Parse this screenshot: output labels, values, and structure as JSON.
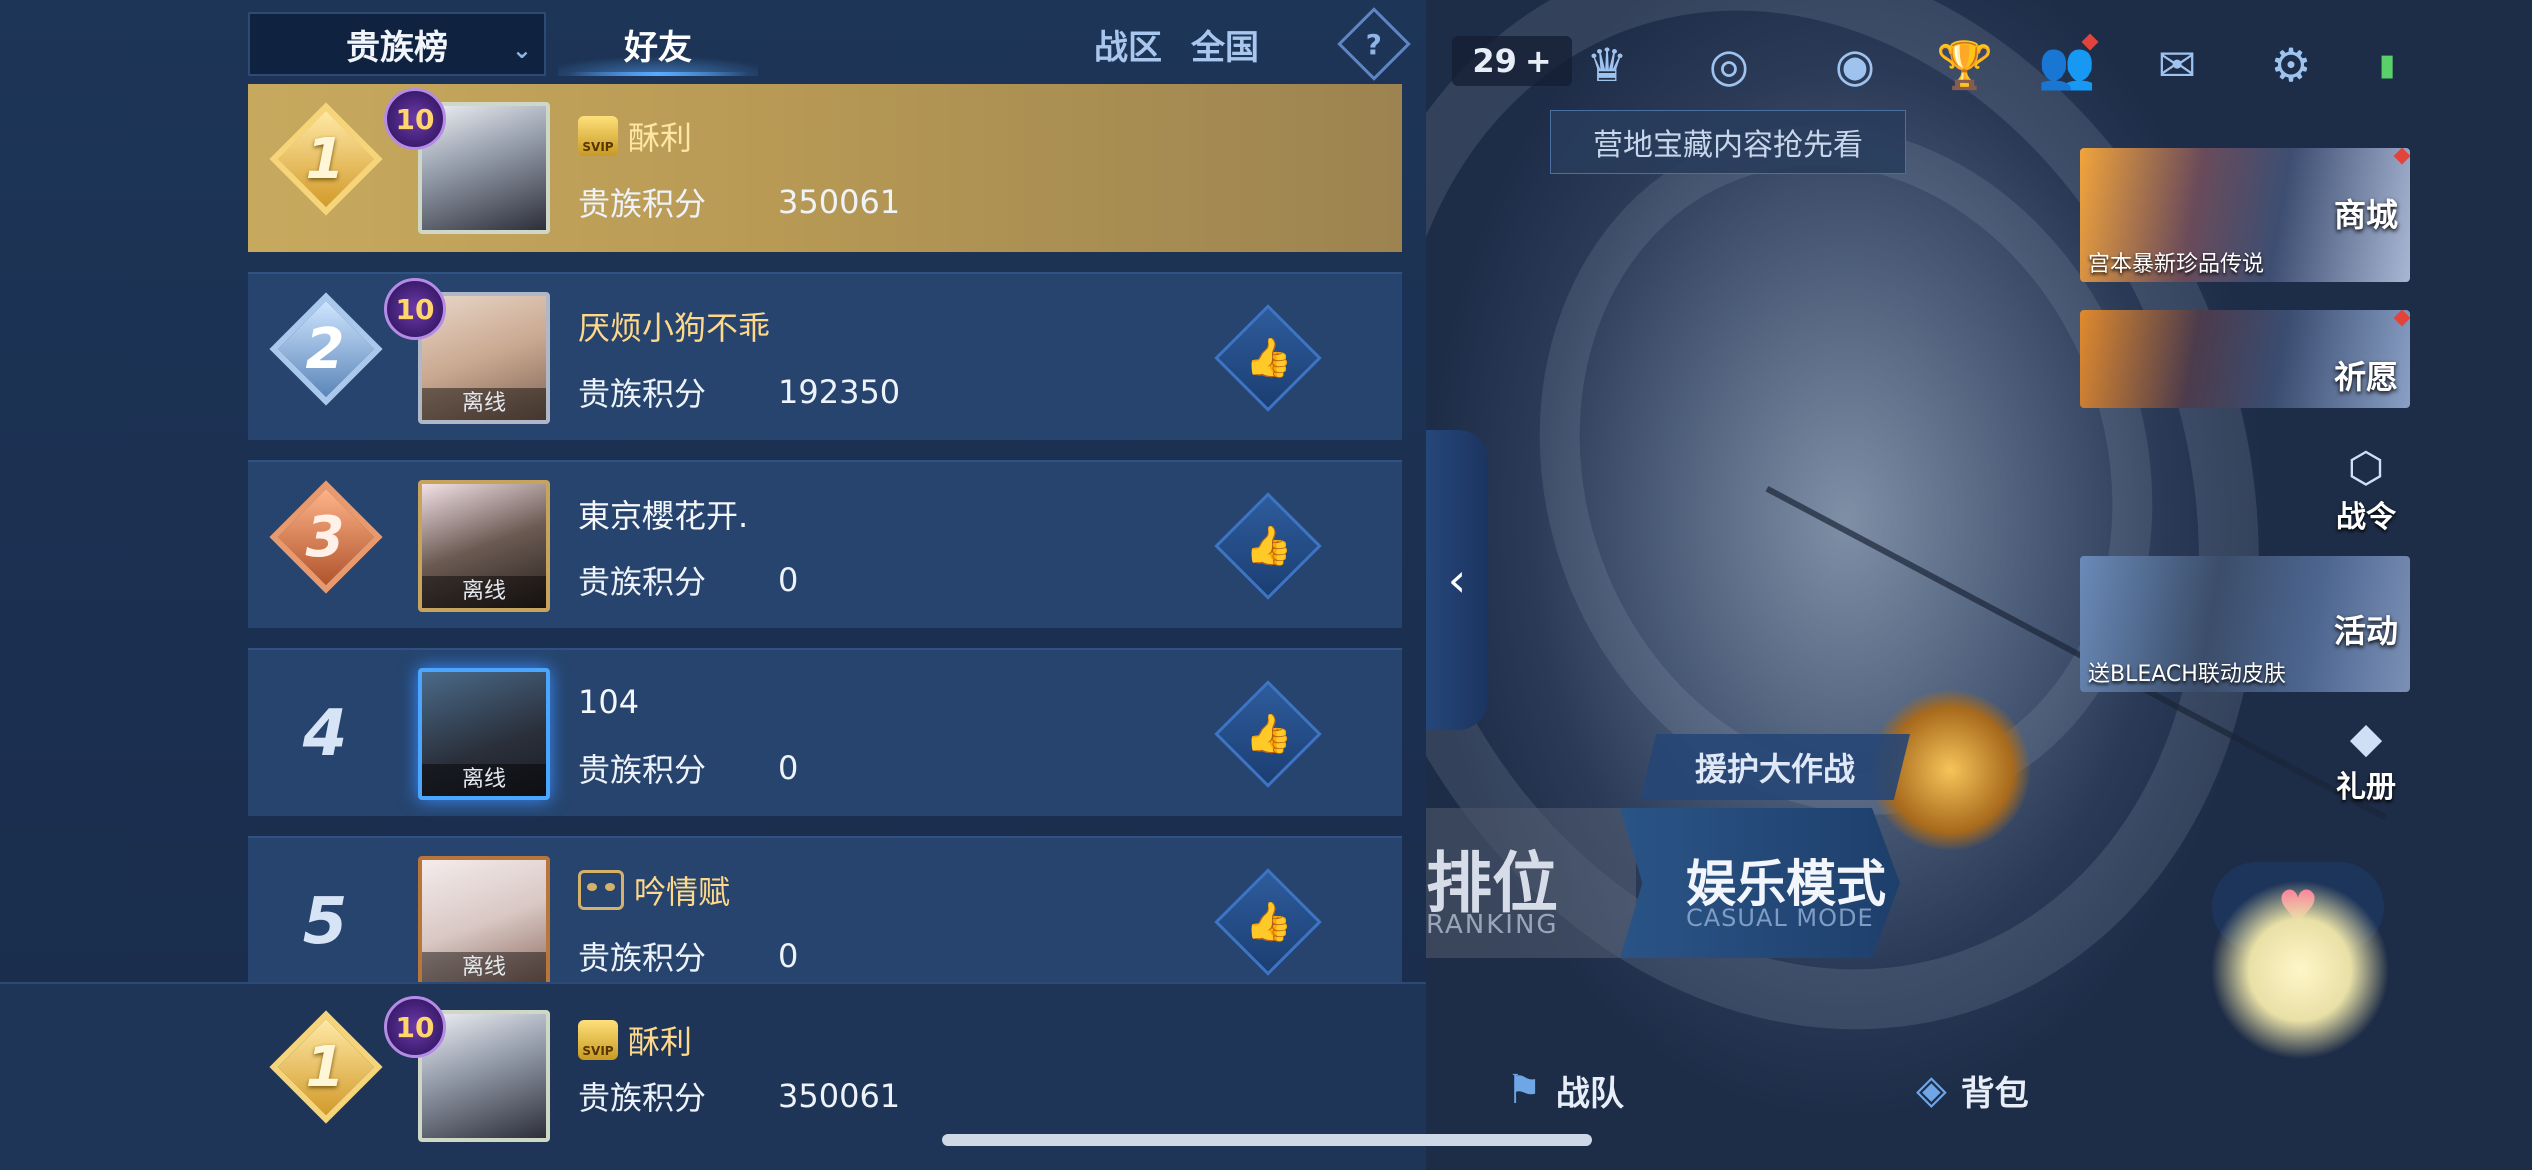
{
  "header": {
    "board_select": "贵族榜",
    "tabs": [
      {
        "label": "好友",
        "active": true
      },
      {
        "label": "战区",
        "active": false
      },
      {
        "label": "全国",
        "active": false
      }
    ],
    "help": "?"
  },
  "leaderboard": {
    "score_label": "贵族积分",
    "offline_label": "离线",
    "rows": [
      {
        "rank": "1",
        "level": "10",
        "name": "酥利",
        "badge": "SVIP",
        "score": "350061",
        "offline": false
      },
      {
        "rank": "2",
        "level": "10",
        "name": "厌烦小狗不乖",
        "score": "192350",
        "offline": true
      },
      {
        "rank": "3",
        "name": "東京櫻花开.",
        "score": "0",
        "offline": true
      },
      {
        "rank": "4",
        "name": "104",
        "score": "0",
        "offline": true
      },
      {
        "rank": "5",
        "name": "吟情赋",
        "score": "0",
        "offline": true
      }
    ],
    "self": {
      "rank": "1",
      "level": "10",
      "name": "酥利",
      "badge": "SVIP",
      "score": "350061"
    }
  },
  "hud": {
    "gem_count": "29",
    "tooltip": "营地宝藏内容抢先看"
  },
  "side_menu": {
    "shop": {
      "label": "商城",
      "subtitle": "宫本暴新珍品传说"
    },
    "wish": {
      "label": "祈愿"
    },
    "battle_pass": {
      "label": "战令"
    },
    "event": {
      "label": "活动",
      "subtitle": "送BLEACH联动皮肤"
    },
    "gift": {
      "label": "礼册"
    }
  },
  "modes": {
    "rescue": "援护大作战",
    "ranked": "排位",
    "ranked_sub": "RANKING",
    "casual": "娱乐模式",
    "casual_sub": "CASUAL MODE"
  },
  "bottom_nav": {
    "team": "战队",
    "bag": "背包"
  },
  "colors": {
    "gold_row": "#c7a95e",
    "panel_bg": "#1d3557",
    "row_bg": "#26446d",
    "accent_blue": "#5aaaff"
  }
}
